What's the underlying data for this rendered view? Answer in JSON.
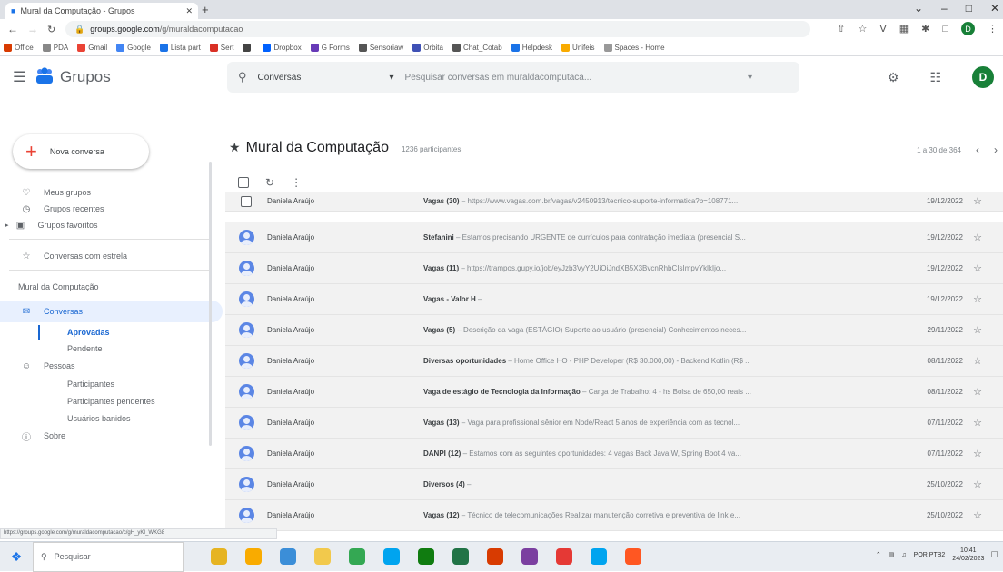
{
  "browser": {
    "tab_title": "Mural da Computação - Grupos",
    "url_domain": "groups.google.com",
    "url_path": "/g/muraldacomputacao",
    "bookmarks": [
      {
        "label": "Office",
        "color": "#d83b01"
      },
      {
        "label": "PDA",
        "color": "#888888"
      },
      {
        "label": "Gmail",
        "color": "#ea4335"
      },
      {
        "label": "Google",
        "color": "#4285f4"
      },
      {
        "label": "Lista part",
        "color": "#1a73e8"
      },
      {
        "label": "Sert",
        "color": "#d93025"
      },
      {
        "label": "",
        "color": "#444444"
      },
      {
        "label": "Dropbox",
        "color": "#0061fe"
      },
      {
        "label": "G Forms",
        "color": "#673ab7"
      },
      {
        "label": "Sensoriaw",
        "color": "#555555"
      },
      {
        "label": "Orbita",
        "color": "#3f51b5"
      },
      {
        "label": "Chat_Cotab",
        "color": "#555555"
      },
      {
        "label": "Helpdesk",
        "color": "#1a73e8"
      },
      {
        "label": "Unifeis",
        "color": "#f9ab00"
      },
      {
        "label": "Spaces - Home",
        "color": "#999999"
      }
    ]
  },
  "header": {
    "brand": "Grupos",
    "search_scope": "Conversas",
    "search_placeholder": "Pesquisar conversas em muraldacomputaca..."
  },
  "sidebar": {
    "new_conversation": "Nova conversa",
    "my_groups": "Meus grupos",
    "recent_groups": "Grupos recentes",
    "favorite_groups": "Grupos favoritos",
    "starred": "Conversas com estrela",
    "group_section": "Mural da Computação",
    "conversations": "Conversas",
    "approved": "Aprovadas",
    "pending": "Pendente",
    "people": "Pessoas",
    "participants": "Participantes",
    "pending_participants": "Participantes pendentes",
    "banned_users": "Usuários banidos",
    "about": "Sobre"
  },
  "main": {
    "group_title": "Mural da Computação",
    "participants": "1236 participantes",
    "pagination": "1 a 30 de 364",
    "conversations": [
      {
        "author": "Daniela Araújo",
        "title": "Vagas (30)",
        "snippet": " – https://www.vagas.com.br/vagas/v2450913/tecnico-suporte-informatica?b=108771...",
        "date": "19/12/2022"
      },
      {
        "author": "Daniela Araújo",
        "title": "Stefanini",
        "snippet": " – Estamos precisando URGENTE de currículos para contratação imediata (presencial S...",
        "date": "19/12/2022"
      },
      {
        "author": "Daniela Araújo",
        "title": "Vagas (11)",
        "snippet": " – https://trampos.gupy.io/job/eyJzb3VyY2UiOiJndXB5X3BvcnRhbCIsImpvYklkIjo...",
        "date": "19/12/2022"
      },
      {
        "author": "Daniela Araújo",
        "title": "Vagas - Valor H",
        "snippet": " –",
        "date": "19/12/2022"
      },
      {
        "author": "Daniela Araújo",
        "title": "Vagas (5)",
        "snippet": " – Descrição da vaga (ESTÁGIO) Suporte ao usuário (presencial) Conhecimentos neces...",
        "date": "29/11/2022"
      },
      {
        "author": "Daniela Araújo",
        "title": "Diversas oportunidades",
        "snippet": " – Home Office HO - PHP Developer (R$ 30.000,00) - Backend Kotlin (R$ ...",
        "date": "08/11/2022"
      },
      {
        "author": "Daniela Araújo",
        "title": "Vaga de estágio de Tecnologia da Informação",
        "snippet": " – Carga de Trabalho: 4 - hs Bolsa de 650,00 reais ...",
        "date": "08/11/2022"
      },
      {
        "author": "Daniela Araújo",
        "title": "Vagas (13)",
        "snippet": " – Vaga para profissional sênior em Node/React 5 anos de experiência com as tecnol...",
        "date": "07/11/2022"
      },
      {
        "author": "Daniela Araújo",
        "title": "DANPI (12)",
        "snippet": " – Estamos com as seguintes oportunidades: 4 vagas Back Java W, Spring Boot 4 va...",
        "date": "07/11/2022"
      },
      {
        "author": "Daniela Araújo",
        "title": "Diversos (4)",
        "snippet": " –",
        "date": "25/10/2022"
      },
      {
        "author": "Daniela Araújo",
        "title": "Vagas (12)",
        "snippet": " – Técnico de telecomunicações Realizar manutenção corretiva e preventiva de link e...",
        "date": "25/10/2022"
      }
    ]
  },
  "status_bar": "https://groups.google.com/g/muraldacomputacao/c/gH_yKI_WKG8",
  "taskbar": {
    "search_placeholder": "Pesquisar",
    "lang": "POR PTB2",
    "time": "10:41",
    "date": "24/02/2023",
    "app_colors": [
      "#e6b422",
      "#f9ab00",
      "#3b8ed8",
      "#f2c94c",
      "#34a853",
      "#00a4ef",
      "#107c10",
      "#217346",
      "#d83b01",
      "#7b3fa0",
      "#e53935",
      "#00a4ef",
      "#ff5722"
    ]
  }
}
